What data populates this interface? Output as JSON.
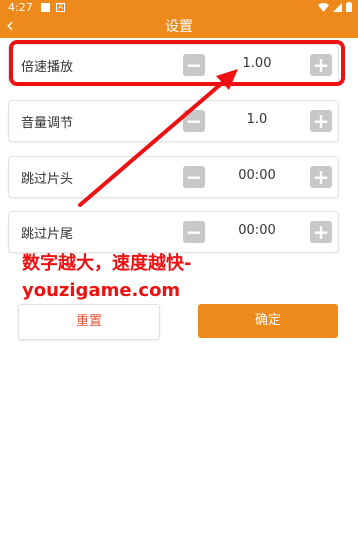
{
  "status": {
    "time": "4:27",
    "sd_glyph": "A"
  },
  "appbar": {
    "back_glyph": "‹",
    "title": "设置"
  },
  "settings": [
    {
      "label": "倍速播放",
      "value": "1.00",
      "minus": "−",
      "plus": "+"
    },
    {
      "label": "音量调节",
      "value": "1.0",
      "minus": "−",
      "plus": "+"
    },
    {
      "label": "跳过片头",
      "value": "00:00",
      "minus": "−",
      "plus": "+"
    },
    {
      "label": "跳过片尾",
      "value": "00:00",
      "minus": "−",
      "plus": "+"
    }
  ],
  "annotation": {
    "line1": "数字越大，速度越快-",
    "line2": "youzigame.com",
    "color": "#ee1111"
  },
  "buttons": {
    "reset": "重置",
    "confirm": "确定"
  },
  "colors": {
    "accent": "#ee8a1c",
    "stepper": "#c8c8c8",
    "reset_text": "#e0553b"
  }
}
